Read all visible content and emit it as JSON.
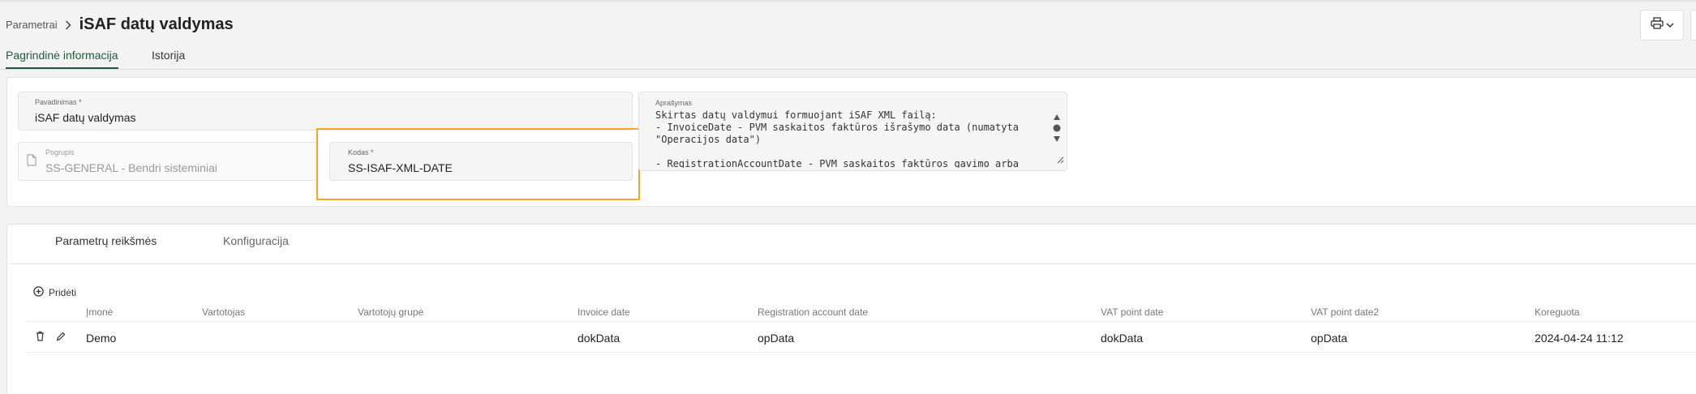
{
  "breadcrumb": {
    "parent": "Parametrai",
    "title": "iSAF datų valdymas"
  },
  "tabs": [
    {
      "label": "Pagrindinė informacija",
      "active": true
    },
    {
      "label": "Istorija",
      "active": false
    }
  ],
  "form": {
    "name": {
      "label": "Pavadinimas *",
      "value": "iSAF datų valdymas"
    },
    "subgroup": {
      "label": "Pogrupis",
      "value": "SS-GENERAL - Bendri sisteminiai"
    },
    "code": {
      "label": "Kodas *",
      "value": "SS-ISAF-XML-DATE"
    },
    "description": {
      "label": "Aprašymas",
      "value": "Skirtas datų valdymui formuojant iSAF XML failą:\n- InvoiceDate - PVM saskaitos faktūros išrašymo data (numatyta\n\"Operacijos data\")\n\n- RegistrationAccountDate - PVM saskaitos faktūros gavimo arba"
    }
  },
  "subtabs": {
    "params": "Parametrų reikšmės",
    "config": "Konfiguracija"
  },
  "table": {
    "add_label": "Pridėti",
    "columns": [
      "Įmonė",
      "Vartotojas",
      "Vartotojų grupė",
      "Invoice date",
      "Registration account date",
      "VAT point date",
      "VAT point date2",
      "Koreguota"
    ],
    "rows": [
      {
        "company": "Demo",
        "user": "",
        "user_group": "",
        "invoice_date": "dokData",
        "registration_account_date": "opData",
        "vat_point_date": "dokData",
        "vat_point_date2": "opData",
        "modified": "2024-04-24 11:12"
      }
    ]
  },
  "colors": {
    "accent": "#1d5b3f",
    "highlight": "#f5a623"
  }
}
